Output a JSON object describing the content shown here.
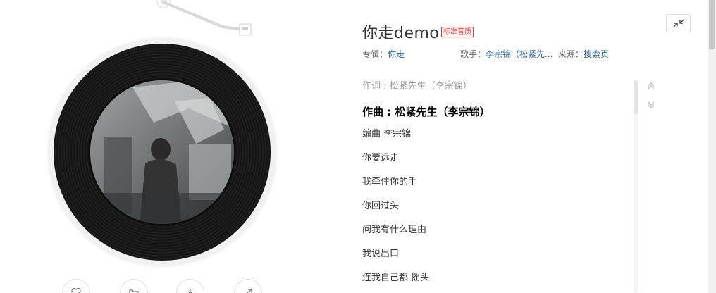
{
  "song": {
    "title": "你走demo",
    "quality_badge": "标准音质",
    "album_label": "专辑：",
    "album": "你走",
    "singer_label": "歌手：",
    "singer": "李宗锦（松紧先...",
    "source_label": "来源：",
    "source": "搜索页"
  },
  "lyrics": [
    "作词 : 松紧先生（李宗锦）",
    "作曲 : 松紧先生（李宗锦）",
    "编曲 李宗锦",
    "你要远走",
    "我牵住你的手",
    "你回过头",
    "问我有什么理由",
    "我说出口",
    "连我自己都 摇头"
  ],
  "icons": {
    "minimize": "collapse-arrows-icon",
    "lyrics_up": "double-chevron-up-icon",
    "lyrics_down": "double-chevron-down-icon",
    "actions": [
      "heart-icon",
      "folder-icon",
      "download-icon",
      "share-icon"
    ]
  },
  "colors": {
    "link": "#31649b",
    "badge": "#e33333"
  }
}
